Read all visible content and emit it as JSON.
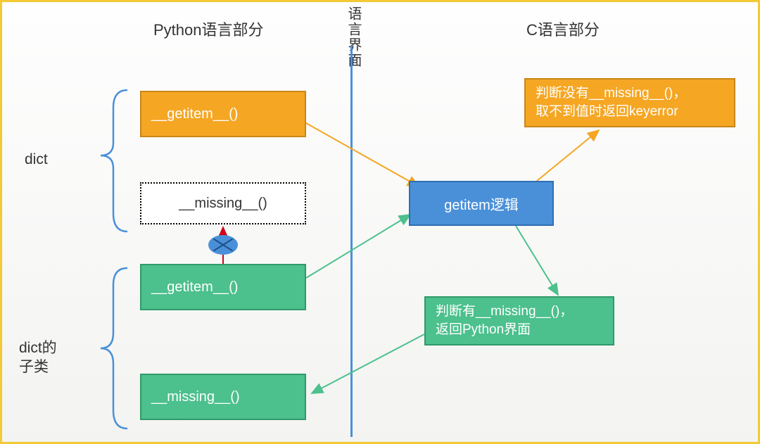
{
  "headers": {
    "left": "Python语言部分",
    "center": "语言界面",
    "right": "C语言部分"
  },
  "groups": {
    "dict": "dict",
    "subclass": "dict的\n子类"
  },
  "nodes": {
    "py_getitem_dict": "__getitem__()",
    "py_missing_dict": "__missing__()",
    "py_getitem_sub": "__getitem__()",
    "py_missing_sub": "__missing__()",
    "c_getitem": "getitem逻辑",
    "c_no_missing": "判断没有__missing__()，\n取不到值时返回keyerror",
    "c_has_missing": "判断有__missing__()，\n返回Python界面"
  },
  "colors": {
    "orange": "#f5a623",
    "green": "#4cc08d",
    "blue": "#4a90d9",
    "frame": "#f5c933"
  }
}
